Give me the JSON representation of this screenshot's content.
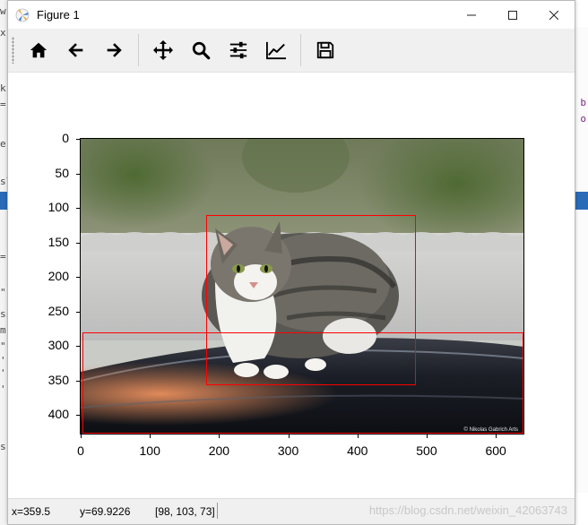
{
  "window": {
    "title": "Figure 1",
    "minimize_glyph": "—",
    "maximize_glyph": "☐",
    "close_glyph": "✕"
  },
  "toolbar": {
    "buttons": [
      {
        "name": "home",
        "icon": "home-icon"
      },
      {
        "name": "back",
        "icon": "arrow-left-icon"
      },
      {
        "name": "forward",
        "icon": "arrow-right-icon"
      },
      {
        "name": "pan",
        "icon": "move-icon"
      },
      {
        "name": "zoom",
        "icon": "magnifier-icon"
      },
      {
        "name": "subplots",
        "icon": "sliders-icon"
      },
      {
        "name": "edit-axes",
        "icon": "line-chart-icon"
      },
      {
        "name": "save",
        "icon": "floppy-disk-icon"
      }
    ]
  },
  "axes": {
    "x_ticks": [
      "0",
      "100",
      "200",
      "300",
      "400",
      "500",
      "600"
    ],
    "y_ticks": [
      "0",
      "50",
      "100",
      "150",
      "200",
      "250",
      "300",
      "350",
      "400"
    ],
    "xlim": [
      0,
      640
    ],
    "ylim": [
      427,
      0
    ]
  },
  "image": {
    "subject": "tabby cat sitting on a car roof",
    "credit": "© Nikolas Gabrich Arts"
  },
  "boxes": [
    {
      "label": "cat",
      "x0": 181,
      "y0": 110,
      "x1": 484,
      "y1": 357,
      "color": "#ff0000"
    },
    {
      "label": "car",
      "x0": 2,
      "y0": 280,
      "x1": 640,
      "y1": 427,
      "color": "#ff0000"
    }
  ],
  "statusbar": {
    "x_readout": "x=359.5",
    "y_readout": "y=69.9226",
    "pixel_value": "[98, 103, 73]",
    "watermark": "https://blog.csdn.net/weixin_42063743"
  },
  "background_app": {
    "left_fragments": [
      "w",
      "x:",
      "k",
      "=",
      "er",
      "sl",
      "=",
      "\"",
      "ss",
      "m",
      "\"",
      "'",
      "'",
      "'",
      "s"
    ],
    "right_fragments": [
      "b",
      "o"
    ]
  }
}
